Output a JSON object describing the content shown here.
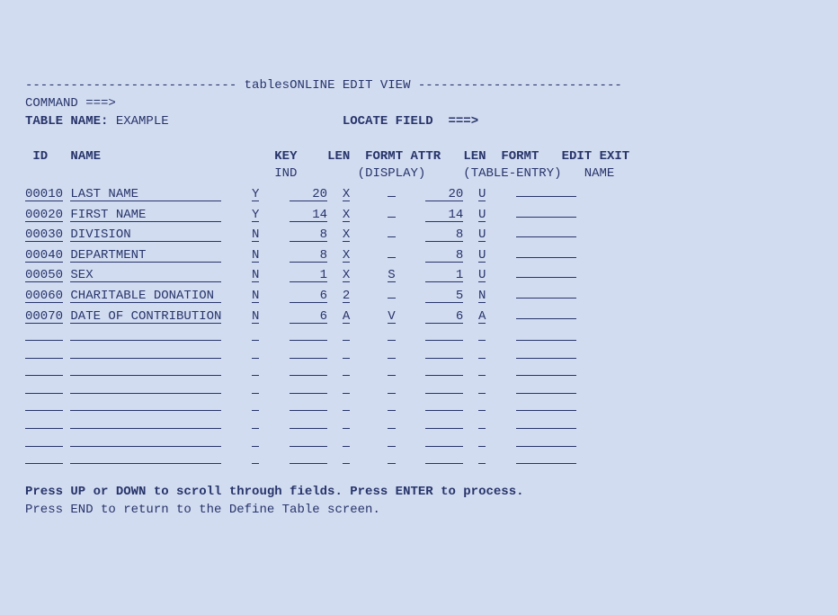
{
  "title_dashes_left": "----------------------------",
  "title_text": "tablesONLINE EDIT VIEW",
  "title_dashes_right": "---------------------------",
  "command_label": "COMMAND ===>",
  "table_name_label": "TABLE NAME:",
  "table_name_value": "EXAMPLE",
  "locate_field_label": "LOCATE FIELD  ===>",
  "header1": {
    "id": "ID",
    "name": "NAME",
    "key": "KEY",
    "len1": "LEN",
    "formt1": "FORMT",
    "attr": "ATTR",
    "len2": "LEN",
    "formt2": "FORMT",
    "editexit": "EDIT EXIT"
  },
  "header2": {
    "ind": "IND",
    "display": "(DISPLAY)",
    "tableentry": "(TABLE-ENTRY)",
    "name": "NAME"
  },
  "rows": [
    {
      "id": "00010",
      "name": "LAST NAME",
      "key": "Y",
      "len1": "20",
      "formt1": "X",
      "attr": "",
      "len2": "20",
      "formt2": "U",
      "exit": ""
    },
    {
      "id": "00020",
      "name": "FIRST NAME",
      "key": "Y",
      "len1": "14",
      "formt1": "X",
      "attr": "",
      "len2": "14",
      "formt2": "U",
      "exit": ""
    },
    {
      "id": "00030",
      "name": "DIVISION",
      "key": "N",
      "len1": "8",
      "formt1": "X",
      "attr": "",
      "len2": "8",
      "formt2": "U",
      "exit": ""
    },
    {
      "id": "00040",
      "name": "DEPARTMENT",
      "key": "N",
      "len1": "8",
      "formt1": "X",
      "attr": "",
      "len2": "8",
      "formt2": "U",
      "exit": ""
    },
    {
      "id": "00050",
      "name": "SEX",
      "key": "N",
      "len1": "1",
      "formt1": "X",
      "attr": "S",
      "len2": "1",
      "formt2": "U",
      "exit": ""
    },
    {
      "id": "00060",
      "name": "CHARITABLE DONATION",
      "key": "N",
      "len1": "6",
      "formt1": "2",
      "attr": "",
      "len2": "5",
      "formt2": "N",
      "exit": ""
    },
    {
      "id": "00070",
      "name": "DATE OF CONTRIBUTION",
      "key": "N",
      "len1": "6",
      "formt1": "A",
      "attr": "V",
      "len2": "6",
      "formt2": "A",
      "exit": ""
    }
  ],
  "empty_rows_count": 8,
  "footer1": "Press UP or DOWN to scroll through fields. Press ENTER to process.",
  "footer2": "Press END to return to the Define Table screen."
}
